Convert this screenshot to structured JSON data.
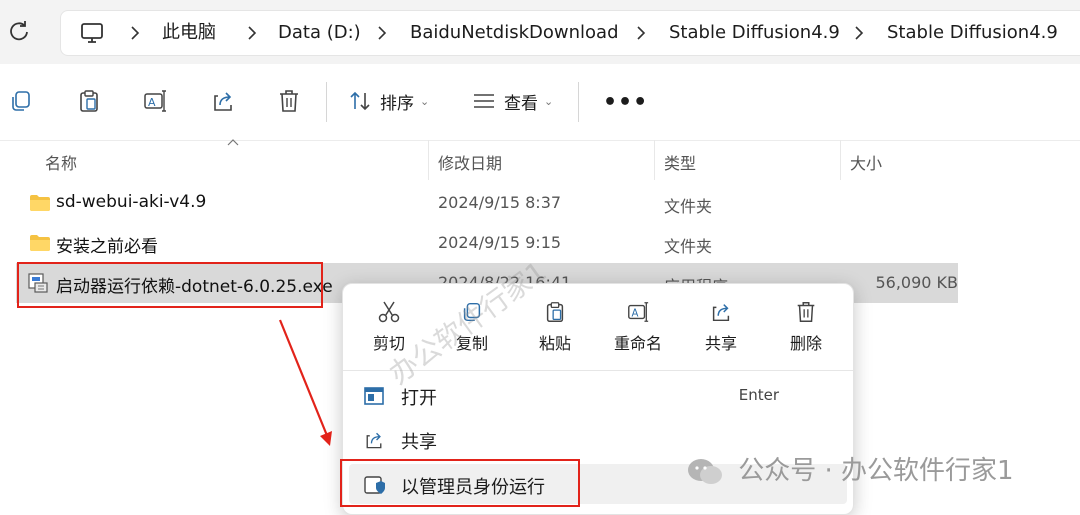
{
  "breadcrumb": [
    "此电脑",
    "Data (D:)",
    "BaiduNetdiskDownload",
    "Stable Diffusion4.9",
    "Stable Diffusion4.9"
  ],
  "toolbar": {
    "sort_label": "排序",
    "view_label": "查看",
    "more_label": "•••"
  },
  "columns": {
    "name": "名称",
    "date": "修改日期",
    "type": "类型",
    "size": "大小"
  },
  "files": [
    {
      "name": "sd-webui-aki-v4.9",
      "date": "2024/9/15 8:37",
      "type": "文件夹",
      "size": ""
    },
    {
      "name": "安装之前必看",
      "date": "2024/9/15 9:15",
      "type": "文件夹",
      "size": ""
    },
    {
      "name": "启动器运行依赖-dotnet-6.0.25.exe",
      "date": "2024/8/22 16:41",
      "type": "应用程序",
      "size": "56,090 KB"
    }
  ],
  "context_menu": {
    "actions": [
      "剪切",
      "复制",
      "粘贴",
      "重命名",
      "共享",
      "删除"
    ],
    "open_label": "打开",
    "open_shortcut": "Enter",
    "share_label": "共享",
    "runas_label": "以管理员身份运行"
  },
  "watermark": {
    "diagonal": "办公软件行家1",
    "footer": "公众号 · 办公软件行家1"
  },
  "colors": {
    "annotation": "#e2231a",
    "folder": "#f5c242",
    "selection": "#d9d9d9"
  }
}
